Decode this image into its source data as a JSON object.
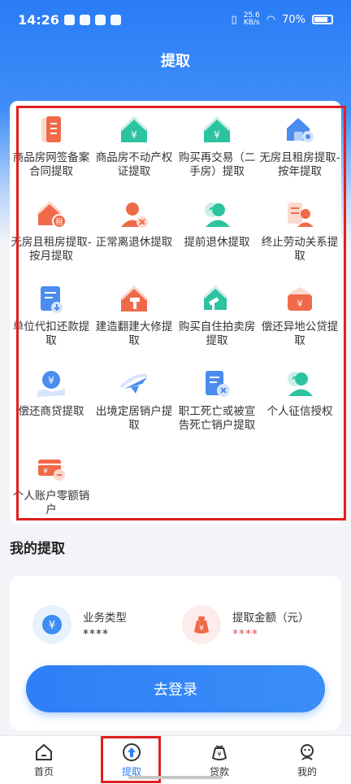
{
  "status_bar": {
    "time": "14:26",
    "speed_top": "25.6",
    "speed_unit": "KB/s",
    "battery": "70%"
  },
  "header": {
    "title": "提取"
  },
  "services": [
    {
      "label": "商品房网签备案合同提取",
      "icon": "contract-document-icon"
    },
    {
      "label": "商品房不动产权证提取",
      "icon": "house-yuan-icon"
    },
    {
      "label": "购买再交易（二手房）提取",
      "icon": "house-yuan-icon"
    },
    {
      "label": "无房且租房提取-按年提取",
      "icon": "house-key-icon"
    },
    {
      "label": "无房且租房提取-按月提取",
      "icon": "house-rent-icon"
    },
    {
      "label": "正常离退休提取",
      "icon": "person-close-icon"
    },
    {
      "label": "提前退休提取",
      "icon": "person-clock-icon"
    },
    {
      "label": "终止劳动关系提取",
      "icon": "person-document-icon"
    },
    {
      "label": "单位代扣还款提取",
      "icon": "document-download-icon"
    },
    {
      "label": "建造翻建大修提取",
      "icon": "house-hammer-icon"
    },
    {
      "label": "购买自住拍卖房提取",
      "icon": "house-gavel-icon"
    },
    {
      "label": "偿还异地公贷提取",
      "icon": "wallet-yuan-icon"
    },
    {
      "label": "偿还商贷提取",
      "icon": "hand-yuan-icon"
    },
    {
      "label": "出境定居销户提取",
      "icon": "airplane-icon"
    },
    {
      "label": "职工死亡或被宣告死亡销户提取",
      "icon": "document-close-icon"
    },
    {
      "label": "个人征信授权",
      "icon": "person-clock-icon"
    },
    {
      "label": "个人账户零额销户",
      "icon": "card-minus-icon"
    }
  ],
  "my_section": {
    "title": "我的提取",
    "business_type_label": "业务类型",
    "business_type_value": "****",
    "amount_label": "提取金额（元）",
    "amount_value": "****",
    "login_label": "去登录"
  },
  "tabs": [
    {
      "label": "首页",
      "icon": "home-icon"
    },
    {
      "label": "提取",
      "icon": "withdraw-icon"
    },
    {
      "label": "贷款",
      "icon": "loan-bag-icon"
    },
    {
      "label": "我的",
      "icon": "profile-icon"
    }
  ],
  "colors": {
    "primary": "#2e7ff6",
    "icon_orange": "#f06a4a",
    "icon_green": "#2cc3a0",
    "icon_blue": "#4a8cf0",
    "highlight_frame": "#e02020",
    "amount_red": "#e84a4a"
  }
}
